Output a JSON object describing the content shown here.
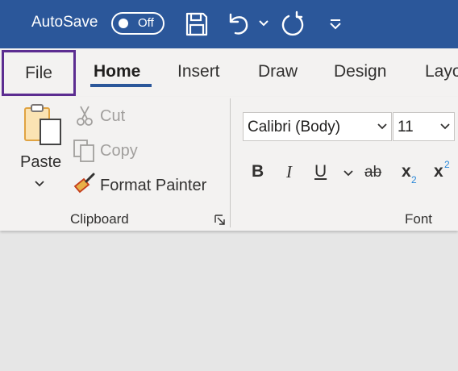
{
  "title_bar": {
    "autosave_label": "AutoSave",
    "autosave_state": "Off",
    "icons": [
      "save-icon",
      "undo-icon",
      "undo-dropdown-chevron-icon",
      "redo-icon",
      "customize-quick-access-icon"
    ]
  },
  "tabs": [
    {
      "label": "File",
      "active": false,
      "highlighted": true
    },
    {
      "label": "Home",
      "active": true
    },
    {
      "label": "Insert"
    },
    {
      "label": "Draw"
    },
    {
      "label": "Design"
    },
    {
      "label": "Layo"
    }
  ],
  "clipboard": {
    "paste_label": "Paste",
    "cut_label": "Cut",
    "copy_label": "Copy",
    "format_painter_label": "Format Painter",
    "group_label": "Clipboard"
  },
  "font": {
    "font_name": "Calibri (Body)",
    "font_size": "11",
    "bold_label": "B",
    "italic_label": "I",
    "underline_label": "U",
    "strikethrough_label": "ab",
    "subscript_base": "x",
    "subscript_index": "2",
    "superscript_base": "x",
    "superscript_index": "2",
    "group_label": "Font"
  },
  "colors": {
    "title_bar": "#2b579a",
    "file_tab_outline": "#5c2d91",
    "home_underline": "#2b579a",
    "ribbon": "#f3f2f1",
    "document_area": "#e6e6e6",
    "format_painter_brush": "#e8b047",
    "script_index": "#2b88d8"
  }
}
